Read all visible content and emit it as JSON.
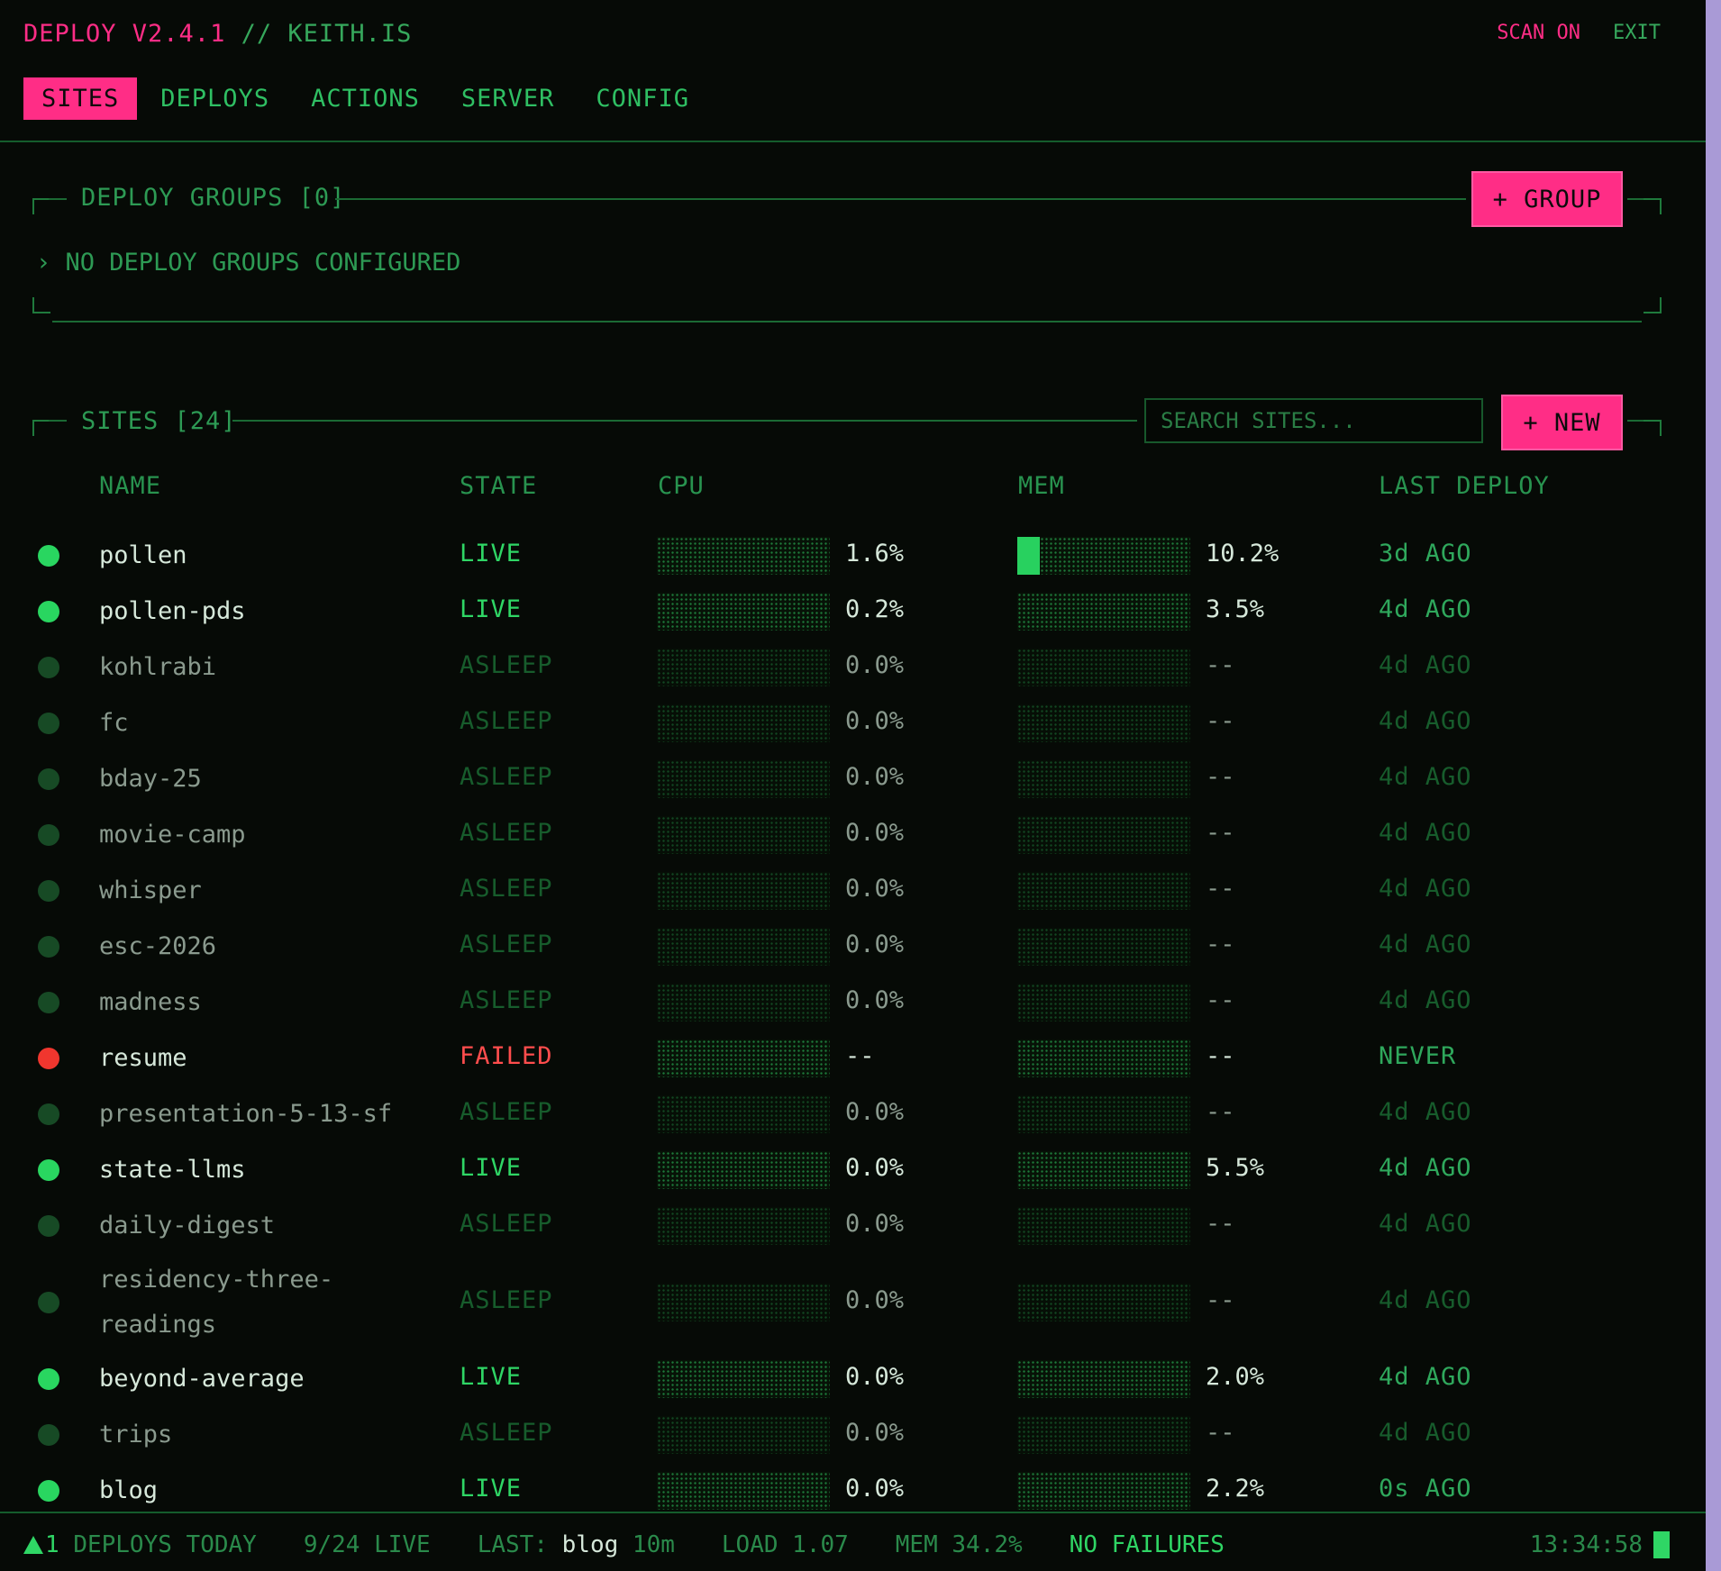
{
  "header": {
    "app_name": "DEPLOY V2.4.1",
    "separator": " // ",
    "host": "KEITH.IS",
    "scan_label": "SCAN ON",
    "exit_label": "EXIT"
  },
  "tabs": [
    "SITES",
    "DEPLOYS",
    "ACTIONS",
    "SERVER",
    "CONFIG"
  ],
  "active_tab": "SITES",
  "groups": {
    "title": "DEPLOY GROUPS [0]",
    "add_button": "+ GROUP",
    "empty_message": "› NO DEPLOY GROUPS CONFIGURED"
  },
  "sites": {
    "title": "SITES [24]",
    "search_placeholder": "SEARCH SITES...",
    "new_button": "+ NEW",
    "columns": [
      "NAME",
      "STATE",
      "CPU",
      "MEM",
      "LAST DEPLOY"
    ],
    "rows": [
      {
        "name": "pollen",
        "state": "LIVE",
        "cpu": "1.6%",
        "mem": "10.2%",
        "mem_fill": 0.13,
        "last": "3d AGO"
      },
      {
        "name": "pollen-pds",
        "state": "LIVE",
        "cpu": "0.2%",
        "mem": "3.5%",
        "mem_fill": 0,
        "last": "4d AGO"
      },
      {
        "name": "kohlrabi",
        "state": "ASLEEP",
        "cpu": "0.0%",
        "mem": "--",
        "mem_fill": 0,
        "last": "4d AGO"
      },
      {
        "name": "fc",
        "state": "ASLEEP",
        "cpu": "0.0%",
        "mem": "--",
        "mem_fill": 0,
        "last": "4d AGO"
      },
      {
        "name": "bday-25",
        "state": "ASLEEP",
        "cpu": "0.0%",
        "mem": "--",
        "mem_fill": 0,
        "last": "4d AGO"
      },
      {
        "name": "movie-camp",
        "state": "ASLEEP",
        "cpu": "0.0%",
        "mem": "--",
        "mem_fill": 0,
        "last": "4d AGO"
      },
      {
        "name": "whisper",
        "state": "ASLEEP",
        "cpu": "0.0%",
        "mem": "--",
        "mem_fill": 0,
        "last": "4d AGO"
      },
      {
        "name": "esc-2026",
        "state": "ASLEEP",
        "cpu": "0.0%",
        "mem": "--",
        "mem_fill": 0,
        "last": "4d AGO"
      },
      {
        "name": "madness",
        "state": "ASLEEP",
        "cpu": "0.0%",
        "mem": "--",
        "mem_fill": 0,
        "last": "4d AGO"
      },
      {
        "name": "resume",
        "state": "FAILED",
        "cpu": "--",
        "mem": "--",
        "mem_fill": 0,
        "last": "NEVER"
      },
      {
        "name": "presentation-5-13-sf",
        "state": "ASLEEP",
        "cpu": "0.0%",
        "mem": "--",
        "mem_fill": 0,
        "last": "4d AGO"
      },
      {
        "name": "state-llms",
        "state": "LIVE",
        "cpu": "0.0%",
        "mem": "5.5%",
        "mem_fill": 0,
        "last": "4d AGO"
      },
      {
        "name": "daily-digest",
        "state": "ASLEEP",
        "cpu": "0.0%",
        "mem": "--",
        "mem_fill": 0,
        "last": "4d AGO"
      },
      {
        "name": "residency-three-readings",
        "name_lines": [
          "residency-three-",
          "readings"
        ],
        "state": "ASLEEP",
        "cpu": "0.0%",
        "mem": "--",
        "mem_fill": 0,
        "last": "4d AGO"
      },
      {
        "name": "beyond-average",
        "state": "LIVE",
        "cpu": "0.0%",
        "mem": "2.0%",
        "mem_fill": 0,
        "last": "4d AGO"
      },
      {
        "name": "trips",
        "state": "ASLEEP",
        "cpu": "0.0%",
        "mem": "--",
        "mem_fill": 0,
        "last": "4d AGO"
      },
      {
        "name": "blog",
        "state": "LIVE",
        "cpu": "0.0%",
        "mem": "2.2%",
        "mem_fill": 0,
        "last": "0s AGO"
      }
    ]
  },
  "footer": {
    "deploys_count": "1",
    "deploys_label": "DEPLOYS TODAY",
    "live": "9/24 LIVE",
    "last_label": "LAST:",
    "last_site": "blog",
    "last_ago": "10m",
    "load": "LOAD 1.07",
    "mem": "MEM 34.2%",
    "failures": "NO FAILURES",
    "clock": "13:34:58"
  },
  "colors": {
    "accent": "#ff2d86",
    "live": "#29d660",
    "failed": "#f0362e",
    "background": "#060a06"
  }
}
